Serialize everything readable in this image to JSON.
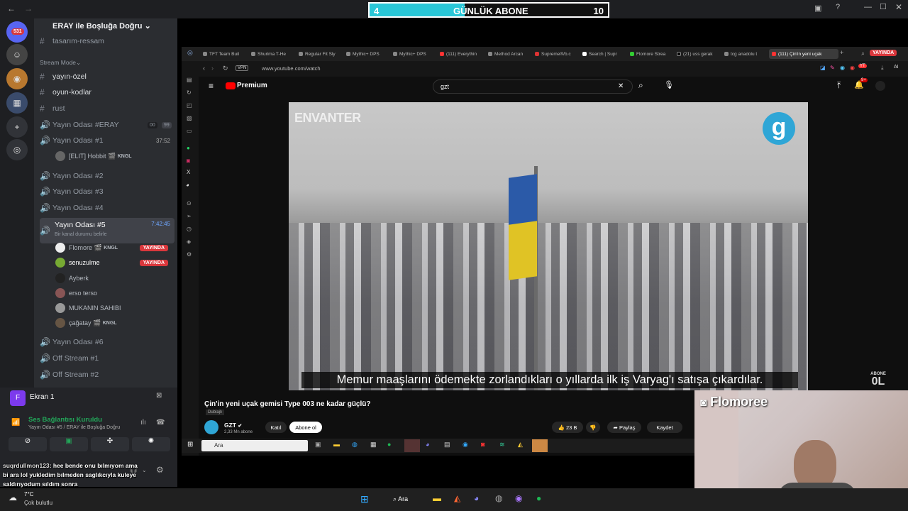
{
  "overlay": {
    "sub_goal_current": "4",
    "sub_goal_label": "GÜNLÜK ABONE",
    "sub_goal_target": "10",
    "sub_goal_progress": 0.4
  },
  "servers": {
    "notification_count": "531"
  },
  "channels": {
    "server_name": "ERAY ile Boşluğa Doğru",
    "items": [
      {
        "name": "tasarım-ressam",
        "type": "text"
      },
      {
        "name": "Stream Mode",
        "type": "category"
      },
      {
        "name": "yayın-özel",
        "type": "text"
      },
      {
        "name": "oyun-kodlar",
        "type": "text"
      },
      {
        "name": "rust",
        "type": "text"
      },
      {
        "name": "Yayın Odası #ERAY",
        "type": "voice",
        "badge_a": "00",
        "badge_b": "99"
      },
      {
        "name": "Yayın Odası #1",
        "type": "voice",
        "time": "37:52"
      },
      {
        "name": "Yayın Odası #2",
        "type": "voice"
      },
      {
        "name": "Yayın Odası #3",
        "type": "voice"
      },
      {
        "name": "Yayın Odası #4",
        "type": "voice"
      },
      {
        "name": "Yayın Odası #5",
        "type": "voice",
        "time": "7:42:45",
        "status": "Bir kanal durumu belirle"
      },
      {
        "name": "Yayın Odası #6",
        "type": "voice"
      },
      {
        "name": "Off Stream #1",
        "type": "voice"
      },
      {
        "name": "Off Stream #2",
        "type": "voice"
      }
    ],
    "room1_users": [
      {
        "name": "[ELIT] Hobbit",
        "tag": "KNGL"
      }
    ],
    "room5_users": [
      {
        "name": "Flomore",
        "tag": "KNGL",
        "live": "YAYINDA"
      },
      {
        "name": "senuzulme",
        "live": "YAYINDA"
      },
      {
        "name": "Ayberk"
      },
      {
        "name": "erso terso"
      },
      {
        "name": "MUKANIN SAHIBI"
      },
      {
        "name": "çağatay",
        "tag": "KNGL"
      }
    ]
  },
  "voice_panel": {
    "screen_label": "Ekran 1",
    "status": "Ses Bağlantısı Kuruldu",
    "location": "Yayın Odası #5 / ERAY ile Boşluğa Doğru"
  },
  "chat_overlay": {
    "user": "suqrdullmon123",
    "message": "hee bende onu bılmıyom ama bi ara lol yukledim bılmeden saglıkcıyla kuleye saldırıyodum sıldım sonra"
  },
  "browser": {
    "tabs": [
      "TFT Team Buil",
      "Shurima T-He",
      "Regular Fit Sly",
      "Mythic+ DPS",
      "Mythic+ DPS",
      "(111) Everythin",
      "Method Arcan",
      "Supreme®/b.c",
      "Search | Supr",
      "Flomore Strea",
      "(21) uss gerak",
      "tcg anadolu t",
      "(111) Çin'in yeni uçak"
    ],
    "live_badge": "YAYINDA",
    "url": "www.youtube.com/watch",
    "vpn": "VPN",
    "ai": "AI"
  },
  "youtube": {
    "logo_text": "Premium",
    "search_value": "gzt",
    "notif_count": "9+",
    "video": {
      "watermark": "ENVANTER",
      "channel_logo": "g",
      "subtitle": "Memur maaşlarını ödemekte zorlandıkları o yıllarda ilk iş Varyag'ı satışa çıkardılar."
    },
    "title": "Çin'in yeni uçak gemisi Type 003 ne kadar güçlü?",
    "dubbed": "Dublajlı",
    "channel_name": "GZT",
    "subs": "2,33 Mn abone",
    "join": "Katıl",
    "subscribe": "Abone ol",
    "likes": "23 B",
    "share": "Paylaş",
    "save": "Kaydet"
  },
  "abone_badge": {
    "label": "ABONE",
    "value": "0L"
  },
  "inner_taskbar": {
    "search": "Ara"
  },
  "webcam": {
    "name": "Flomoree"
  },
  "taskbar": {
    "temp": "7°C",
    "weather": "Çok bulutlu",
    "search": "Ara"
  }
}
